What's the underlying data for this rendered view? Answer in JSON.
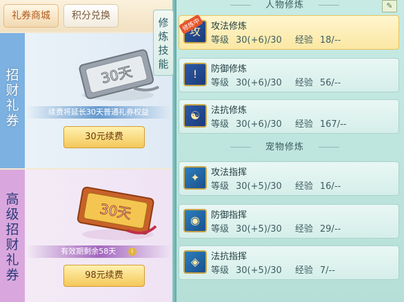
{
  "tabs": {
    "shop": "礼券商城",
    "points": "积分兑换"
  },
  "card1": {
    "label": "招财礼券",
    "ticket_text": "30天",
    "note": "续费将延长30天普通礼券权益",
    "button": "30元续费"
  },
  "card2": {
    "label": "高级招财礼券",
    "ticket_text": "30天",
    "note": "有效期剩余58天",
    "info_icon": "i",
    "button": "98元续费"
  },
  "side_tab": "修炼技能",
  "sections": {
    "person": "人物修炼",
    "pet": "宠物修炼"
  },
  "labels": {
    "level": "等级",
    "exp": "经验"
  },
  "person_items": [
    {
      "name": "攻法修炼",
      "level": "30(+6)/30",
      "exp": "18/--",
      "badge": "修炼中",
      "icon": "攻"
    },
    {
      "name": "防御修炼",
      "level": "30(+6)/30",
      "exp": "56/--",
      "icon": "!"
    },
    {
      "name": "法抗修炼",
      "level": "30(+6)/30",
      "exp": "167/--",
      "icon": "☯"
    }
  ],
  "pet_items": [
    {
      "name": "攻法指挥",
      "level": "30(+5)/30",
      "exp": "16/--",
      "icon": "✦"
    },
    {
      "name": "防御指挥",
      "level": "30(+5)/30",
      "exp": "29/--",
      "icon": "◉"
    },
    {
      "name": "法抗指挥",
      "level": "30(+5)/30",
      "exp": "7/--",
      "icon": "◈"
    }
  ],
  "colors": {
    "active_item": "#fbe7a2",
    "accent_blue": "#7cb1e1",
    "accent_purple": "#d9a7dd"
  }
}
